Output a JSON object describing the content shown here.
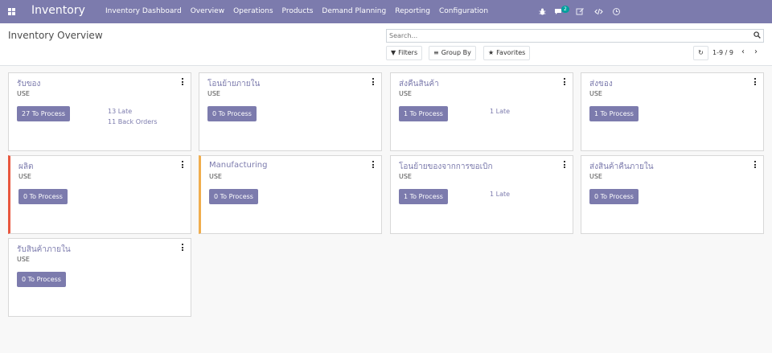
{
  "navbar": {
    "brand": "Inventory",
    "menu": [
      "Inventory Dashboard",
      "Overview",
      "Operations",
      "Products",
      "Demand Planning",
      "Reporting",
      "Configuration"
    ],
    "chat_badge": "2",
    "icons": [
      "bug-icon",
      "chat-icon",
      "edit-icon",
      "code-icon",
      "clock-icon"
    ],
    "color": "#7c7bad"
  },
  "control": {
    "title": "Inventory Overview",
    "search_placeholder": "Search...",
    "filters_label": "Filters",
    "groupby_label": "Group By",
    "favorites_label": "Favorites",
    "pager": "1-9 / 9"
  },
  "cards": [
    {
      "title": "รับของ",
      "sub": "USE",
      "button": "27 To Process",
      "stats": [
        "13 Late",
        "11 Back Orders"
      ]
    },
    {
      "title": "โอนย้ายภายใน",
      "sub": "USE",
      "button": "0 To Process",
      "stats": []
    },
    {
      "title": "ส่งคืนสินค้า",
      "sub": "USE",
      "button": "1 To Process",
      "stats": [
        "1 Late"
      ]
    },
    {
      "title": "ส่งของ",
      "sub": "USE",
      "button": "1 To Process",
      "stats": []
    },
    {
      "title": "ผลิต",
      "sub": "USE",
      "button": "0 To Process",
      "stats": []
    },
    {
      "title": "Manufacturing",
      "sub": "USE",
      "button": "0 To Process",
      "stats": []
    },
    {
      "title": "โอนย้ายของจากการขอเบิก",
      "sub": "USE",
      "button": "1 To Process",
      "stats": [
        "1 Late"
      ]
    },
    {
      "title": "ส่งสินค้าคืนภายใน",
      "sub": "USE",
      "button": "0 To Process",
      "stats": []
    },
    {
      "title": "รับสินค้าภายใน",
      "sub": "USE",
      "button": "0 To Process",
      "stats": []
    }
  ]
}
